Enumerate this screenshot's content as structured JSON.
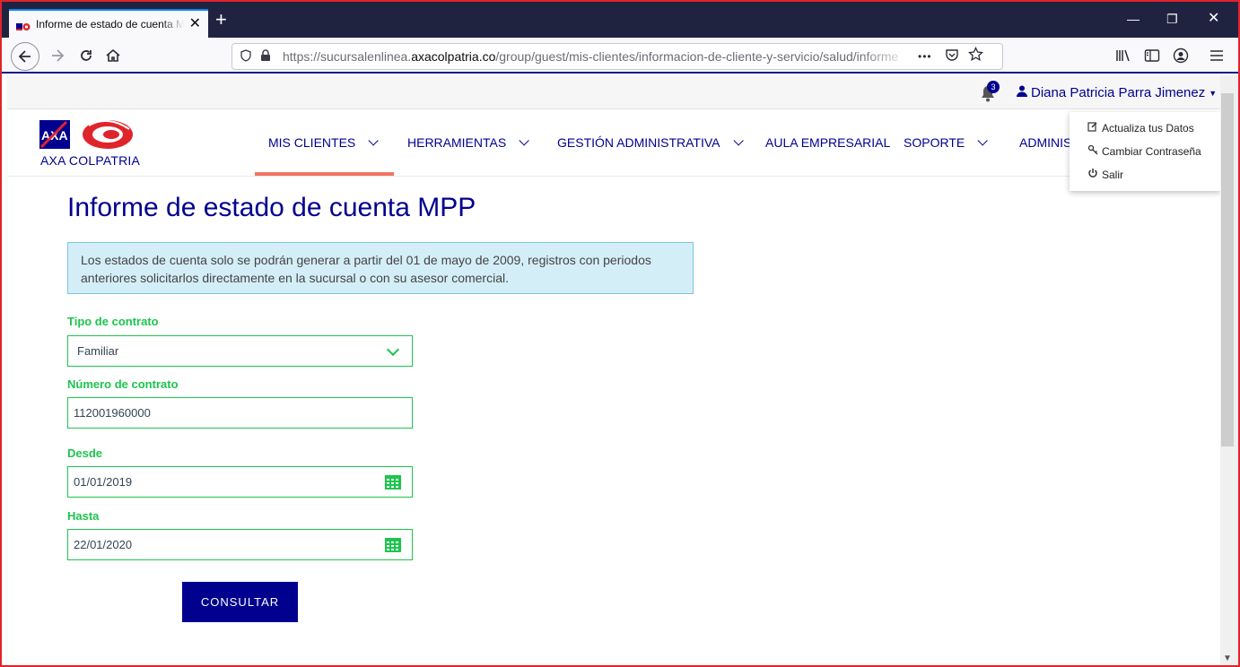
{
  "browser": {
    "tab_title": "Informe de estado de cuenta M",
    "url_prefix": "https://sucursalenlinea.",
    "url_domain": "axacolpatria.co",
    "url_path": "/group/guest/mis-clientes/informacion-de-cliente-y-servicio/salud/informe",
    "url_more": "•••"
  },
  "userbar": {
    "notification_count": "3",
    "user_name": "Diana Patricia Parra Jimenez"
  },
  "brand": {
    "logo_text": "AXA COLPATRIA"
  },
  "nav": {
    "items": [
      {
        "label": "MIS CLIENTES"
      },
      {
        "label": "HERRAMIENTAS"
      },
      {
        "label": "GESTIÓN ADMINISTRATIVA"
      },
      {
        "label": "AULA EMPRESARIAL"
      },
      {
        "label": "SOPORTE"
      },
      {
        "label": "ADMINIST"
      }
    ]
  },
  "user_dropdown": {
    "items": [
      {
        "label": "Actualiza tus Datos"
      },
      {
        "label": "Cambiar Contraseña"
      },
      {
        "label": "Salir"
      }
    ]
  },
  "main": {
    "title": "Informe de estado de cuenta MPP",
    "notice_line1": "Los estados de cuenta solo se podrán generar a partir del 01 de mayo de 2009, registros con periodos",
    "notice_line2": "anteriores solicitarlos directamente en la sucursal o con su asesor comercial."
  },
  "form": {
    "contract_type_label": "Tipo de contrato",
    "contract_type_value": "Familiar",
    "contract_number_label": "Número de contrato",
    "contract_number_value": "112001960000",
    "from_label": "Desde",
    "from_value": "01/01/2019",
    "to_label": "Hasta",
    "to_value": "22/01/2020",
    "submit_label": "CONSULTAR"
  },
  "colors": {
    "brand_blue": "#00008f",
    "field_green": "#1cc54e",
    "accent_red": "#f07662",
    "notice_bg": "#d4eef8"
  }
}
